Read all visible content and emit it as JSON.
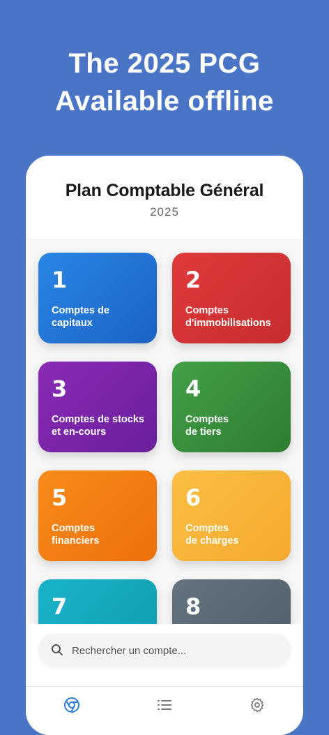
{
  "headline": {
    "line1": "The 2025 PCG",
    "line2": "Available offline"
  },
  "app": {
    "title": "Plan Comptable Général",
    "year": "2025"
  },
  "classes": [
    {
      "number": "1",
      "label": "Comptes de\ncapitaux",
      "color": "#2176d8"
    },
    {
      "number": "2",
      "label": "Comptes\nd'immobilisations",
      "color": "#d63638"
    },
    {
      "number": "3",
      "label": "Comptes de stocks\net en-cours",
      "color": "#7b26a8"
    },
    {
      "number": "4",
      "label": "Comptes\nde tiers",
      "color": "#3a8f3e"
    },
    {
      "number": "5",
      "label": "Comptes\nfinanciers",
      "color": "#f37f14"
    },
    {
      "number": "6",
      "label": "Comptes\nde charges",
      "color": "#f7b53a"
    },
    {
      "number": "7",
      "label": "",
      "color": "#18a9bf"
    },
    {
      "number": "8",
      "label": "",
      "color": "#596a76"
    }
  ],
  "search": {
    "placeholder": "Rechercher un compte..."
  },
  "tabs": {
    "home_icon": "chrome-circle-icon",
    "list_icon": "list-icon",
    "settings_icon": "gear-icon"
  }
}
